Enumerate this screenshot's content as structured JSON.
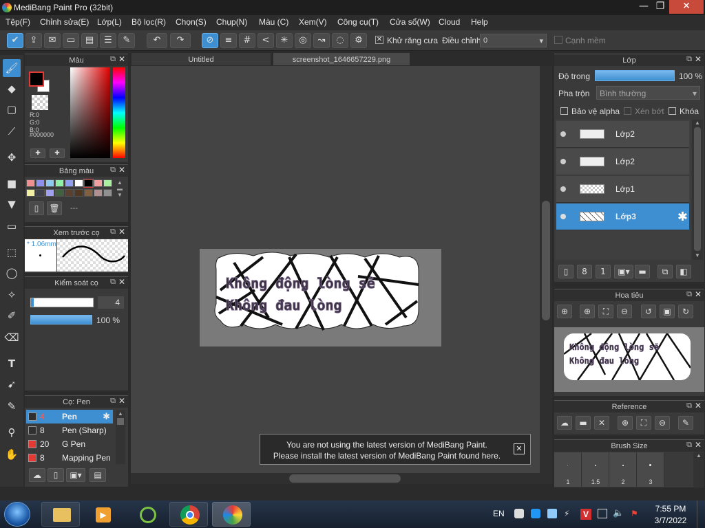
{
  "app": {
    "title": "MediBang Paint Pro (32bit)"
  },
  "window_controls": {
    "minimize": "—",
    "restore": "❐",
    "close": "✕"
  },
  "menu": [
    "Tệp(F)",
    "Chỉnh sửa(E)",
    "Lớp(L)",
    "Bộ lọc(R)",
    "Chọn(S)",
    "Chụp(N)",
    "Màu (C)",
    "Xem(V)",
    "Công cụ(T)",
    "Cửa sổ(W)",
    "Cloud",
    "Help"
  ],
  "toolbar": {
    "antialias_label": "Khử răng cưa",
    "adjust_label": "Điều chỉnh",
    "adjust_value": "0",
    "soft_edge_label": "Cạnh mềm",
    "antialias_check": "✕"
  },
  "tabs": [
    "Untitled",
    "screenshot_1646657229.png"
  ],
  "panels": {
    "color": {
      "title": "Màu",
      "r": "R:0",
      "g": "G:0",
      "b": "B:0",
      "hex": "#000000"
    },
    "palette": {
      "title": "Bảng màu",
      "name": "---",
      "swatches": [
        "#f08f8f",
        "#8f8ff0",
        "#8fc8f0",
        "#8ff0a8",
        "#8fa0f0",
        "#ffffff",
        "#000000",
        "#f0a0a0",
        "#a8f0a0",
        "#f0f0a0",
        "#40404a",
        "#a0a0f0",
        "#406040",
        "#5a4030",
        "#503820",
        "#806040",
        "#b09090",
        "#909090"
      ]
    },
    "brush_preview": {
      "title": "Xem trước cọ",
      "size": "* 1.06mm"
    },
    "brush_control": {
      "title": "Kiểm soát cọ",
      "size_value": "4",
      "opacity_value": "100 %"
    },
    "brush_list": {
      "title": "Cọ: Pen",
      "items": [
        {
          "size": "4",
          "name": "Pen",
          "color": "#303030"
        },
        {
          "size": "8",
          "name": "Pen (Sharp)",
          "color": "#303030"
        },
        {
          "size": "20",
          "name": "G Pen",
          "color": "#e53935"
        },
        {
          "size": "8",
          "name": "Mapping Pen",
          "color": "#e53935"
        }
      ]
    },
    "layers": {
      "title": "Lớp",
      "opacity_label": "Độ trong",
      "opacity_value": "100 %",
      "blend_label": "Pha trộn",
      "blend_value": "Bình thường",
      "protect_alpha": "Bảo vệ alpha",
      "clipping": "Xén bớt",
      "lock": "Khóa",
      "items": [
        {
          "name": "Lớp2",
          "selected": false
        },
        {
          "name": "Lớp2",
          "selected": false
        },
        {
          "name": "Lớp1",
          "selected": false
        },
        {
          "name": "Lớp3",
          "selected": true
        }
      ]
    },
    "navigator": {
      "title": "Hoa tiêu"
    },
    "reference": {
      "title": "Reference"
    },
    "brush_size": {
      "title": "Brush Size",
      "sizes": [
        "1",
        "1.5",
        "2",
        "3"
      ]
    }
  },
  "canvas": {
    "line1": "Không động lòng sẽ",
    "line2": "Không đau lòng"
  },
  "notification": {
    "line1": "You are not using the latest version of MediBang Paint.",
    "line2": "Please install the latest version of MediBang Paint found here.",
    "close": "✕"
  },
  "taskbar": {
    "lang": "EN",
    "time": "7:55 PM",
    "date": "3/7/2022"
  }
}
